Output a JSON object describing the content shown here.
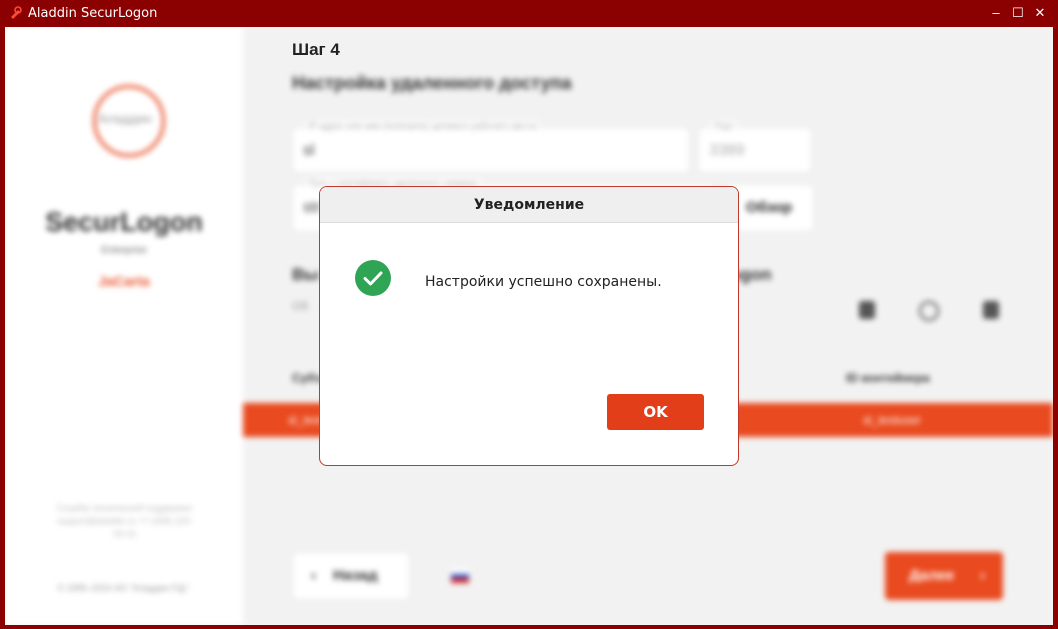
{
  "window": {
    "title": "Aladdin SecurLogon",
    "controls": {
      "minimize": "–",
      "maximize": "☐",
      "close": "✕"
    }
  },
  "sidebar": {
    "logo_text": "Аладдин",
    "product": "SecurLogon",
    "edition": "Enterprise",
    "jacarta": "JaCarta",
    "support": "Служба технической поддержки: support@aladdin.ru +7 (495) 223-00-01",
    "copyright": "© 1995–2024 АО \"Аладдин Р.Д.\""
  },
  "main": {
    "step": "Шаг 4",
    "heading": "Настройка удаленного доступа",
    "host_field": {
      "label": "IP-адрес или имя (hostname) целевого рабочего места",
      "value": "sl"
    },
    "port_field": {
      "label": "Порт",
      "value": "3389"
    },
    "path_field": {
      "label": "Путь к сертификату удаленного сервера",
      "value": "str"
    },
    "browse_label": "Обзор",
    "section_title_start": "Вы",
    "section_title_end": "ogon",
    "section_sub": "Об",
    "table": {
      "col_subject": "Субъ",
      "col_container": "ID контейнера",
      "row": {
        "subject": "sl_test",
        "container": "sl_testuser"
      }
    },
    "back_label": "Назад",
    "next_label": "Далее"
  },
  "dialog": {
    "title": "Уведомление",
    "message": "Настройки успешно сохранены.",
    "ok_label": "OK",
    "icon": "success-check-icon"
  },
  "colors": {
    "titlebar": "#8b0000",
    "accent": "#e23e1a",
    "success": "#2fa454"
  }
}
